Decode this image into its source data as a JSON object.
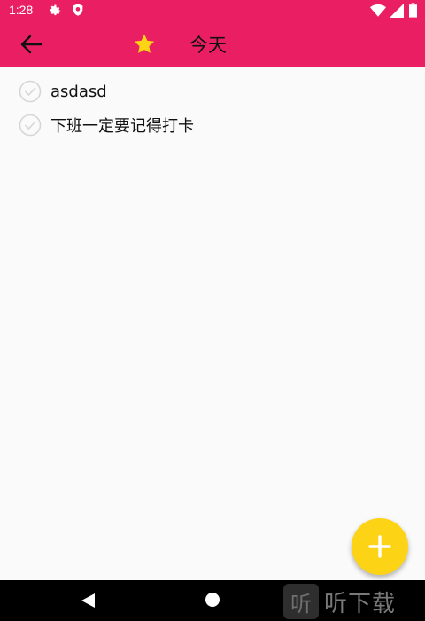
{
  "status_bar": {
    "time": "1:28",
    "icons": [
      "gear-icon",
      "shield-icon",
      "wifi-icon",
      "signal-icon",
      "battery-icon"
    ]
  },
  "app_bar": {
    "title": "今天",
    "back_icon": "arrow-left-icon",
    "star_icon": "star-icon",
    "background": "#ea1f63",
    "star_color": "#fdd415"
  },
  "tasks": [
    {
      "text": "asdasd",
      "done": false
    },
    {
      "text": "下班一定要记得打卡",
      "done": false
    }
  ],
  "fab": {
    "icon": "plus-icon",
    "color": "#fdd415"
  },
  "nav_bar": {
    "icons": [
      "nav-back-icon",
      "nav-home-icon"
    ]
  },
  "watermark": {
    "badge": "听",
    "text": "听下载"
  }
}
